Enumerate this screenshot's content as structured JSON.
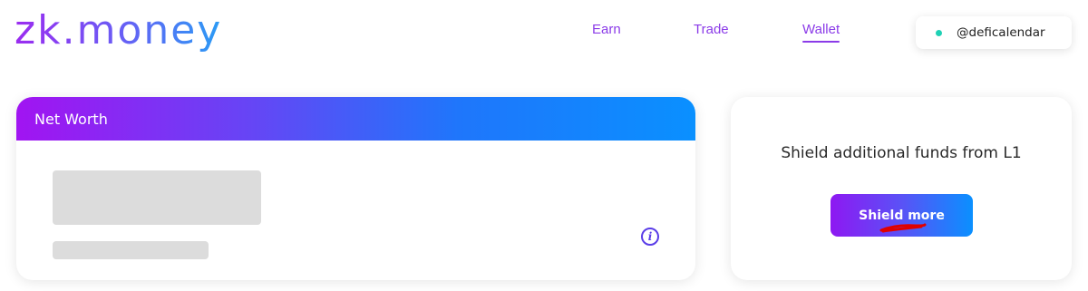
{
  "header": {
    "logo_text": "zk.money",
    "nav": {
      "earn": "Earn",
      "trade": "Trade",
      "wallet": "Wallet"
    },
    "active_nav": "Wallet",
    "account": {
      "username": "@deficalendar",
      "status_color": "#1fd1b5",
      "status_icon": "status-dot-icon"
    }
  },
  "net_worth_card": {
    "title": "Net Worth",
    "info_icon": "info-icon",
    "loading": true
  },
  "shield_card": {
    "description": "Shield additional funds from L1",
    "button_label": "Shield more"
  },
  "colors": {
    "accent_purple": "#8b3be8",
    "gradient_start": "#a114f2",
    "gradient_end": "#0a90ff",
    "annotation_red": "#e00000"
  }
}
